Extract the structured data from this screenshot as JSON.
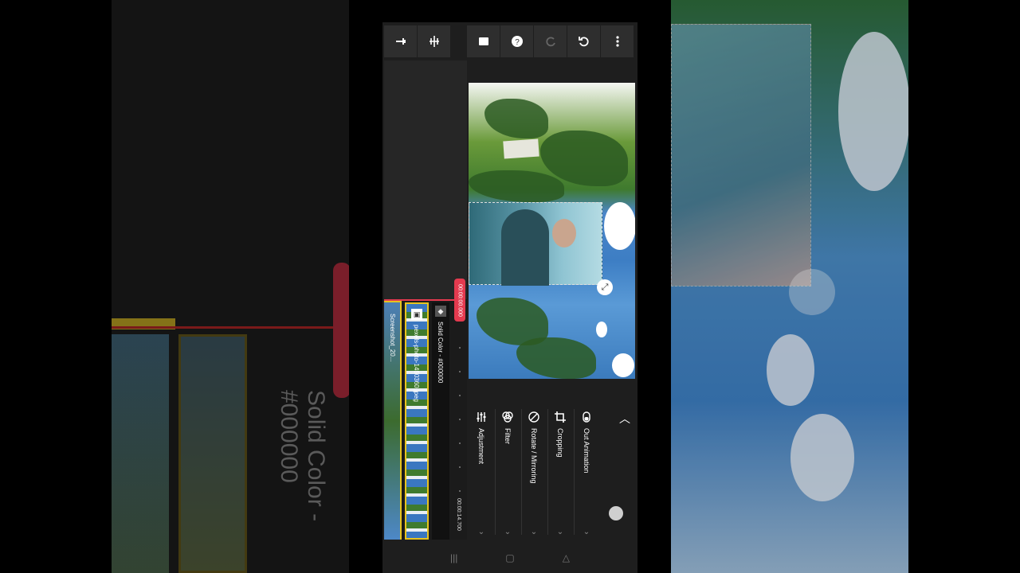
{
  "toolbar": {
    "buttons": [
      {
        "icon": "pin-icon"
      },
      {
        "icon": "split-icon"
      },
      {
        "icon": "camera-icon"
      },
      {
        "icon": "help-icon"
      },
      {
        "icon": "redo-icon"
      },
      {
        "icon": "undo-icon"
      },
      {
        "icon": "more-icon"
      }
    ]
  },
  "timeline": {
    "current_time": "00:00:00.000",
    "end_time": "00:00:14.700",
    "clips": [
      {
        "label": "Screenshot_20..."
      },
      {
        "label": "pexels-photo-1450360.jpeg"
      },
      {
        "label": "Solid Color - #000000"
      }
    ]
  },
  "tools": [
    {
      "label": "Adjustment",
      "icon": "sliders-icon"
    },
    {
      "label": "Filter",
      "icon": "filter-icon"
    },
    {
      "label": "Rotate / Mirroring",
      "icon": "rotate-icon"
    },
    {
      "label": "Cropping",
      "icon": "crop-icon"
    },
    {
      "label": "Out Animation",
      "icon": "animation-icon"
    }
  ],
  "navbar": {
    "recents": "|||",
    "home": "▢",
    "back": "△"
  },
  "colors": {
    "playhead": "#e43a4f",
    "selected_clip_border": "#e7c31e",
    "panel_bg": "#1e1e1e"
  }
}
